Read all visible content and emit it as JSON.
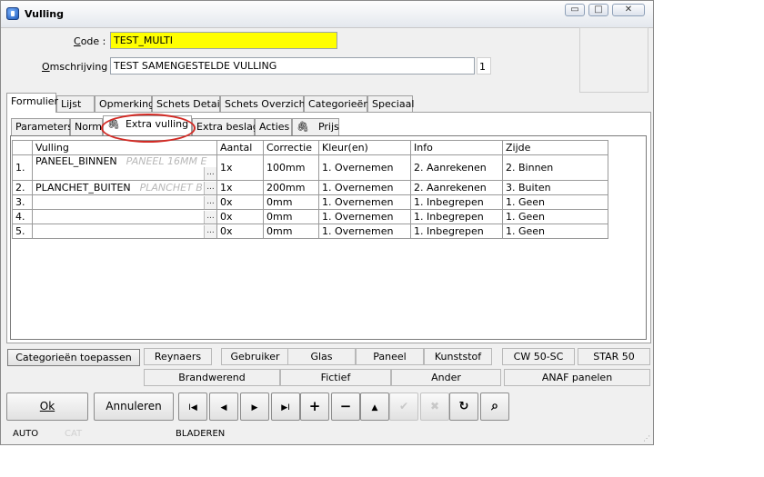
{
  "window": {
    "title": "Vulling",
    "caption_buttons": [
      "minimize",
      "maximize",
      "close"
    ]
  },
  "form": {
    "code_label": "Code :",
    "code_value": "TEST_MULTI",
    "omschrijving_label": "Omschrijving :",
    "omschrijving_value": "TEST SAMENGESTELDE VULLING",
    "omschrijving_count": "1",
    "code_bg": "#ffff00"
  },
  "main_tabs": [
    {
      "label": "Formulier",
      "active": true
    },
    {
      "label": "Lijst"
    },
    {
      "label": "Opmerking"
    },
    {
      "label": "Schets Detail"
    },
    {
      "label": "Schets Overzicht"
    },
    {
      "label": "Categorieën"
    },
    {
      "label": "Speciaal"
    }
  ],
  "sub_tabs": [
    {
      "label": "Parameters"
    },
    {
      "label": "Norm"
    },
    {
      "label": "Extra vulling",
      "active": true,
      "icon": "paperclip-icon"
    },
    {
      "label": "Extra beslag"
    },
    {
      "label": "Acties"
    },
    {
      "label": "Prijs",
      "icon": "paperclip-icon"
    }
  ],
  "grid": {
    "headers": [
      "",
      "Vulling",
      "Aantal",
      "Correctie",
      "Kleur(en)",
      "Info",
      "Zijde"
    ],
    "rows": [
      {
        "nr": "1.",
        "vulling": "PANEEL_BINNEN",
        "desc": "PANEEL 16MM E",
        "aantal": "1x",
        "correctie": "100mm",
        "kleur": "1. Overnemen",
        "info": "2. Aanrekenen",
        "zijde": "2. Binnen"
      },
      {
        "nr": "2.",
        "vulling": "PLANCHET_BUITEN",
        "desc": "PLANCHET B",
        "aantal": "1x",
        "correctie": "200mm",
        "kleur": "1. Overnemen",
        "info": "2. Aanrekenen",
        "zijde": "3. Buiten"
      },
      {
        "nr": "3.",
        "vulling": "",
        "desc": "",
        "aantal": "0x",
        "correctie": "0mm",
        "kleur": "1. Overnemen",
        "info": "1. Inbegrepen",
        "zijde": "1. Geen"
      },
      {
        "nr": "4.",
        "vulling": "",
        "desc": "",
        "aantal": "0x",
        "correctie": "0mm",
        "kleur": "1. Overnemen",
        "info": "1. Inbegrepen",
        "zijde": "1. Geen"
      },
      {
        "nr": "5.",
        "vulling": "",
        "desc": "",
        "aantal": "0x",
        "correctie": "0mm",
        "kleur": "1. Overnemen",
        "info": "1. Inbegrepen",
        "zijde": "1. Geen"
      }
    ],
    "dots_label": "..."
  },
  "categories": {
    "apply_button": "Categorieën toepassen",
    "row1": [
      "Reynaers",
      "Gebruiker",
      "Glas",
      "Paneel",
      "Kunststof",
      "CW 50-SC",
      "STAR 50"
    ],
    "row2": [
      "Brandwerend",
      "Fictief",
      "Ander",
      "ANAF panelen"
    ]
  },
  "buttons": {
    "ok": "Ok",
    "annuleren": "Annuleren",
    "nav": [
      {
        "icon": "first-record-icon",
        "glyph": "I◀",
        "disabled": false
      },
      {
        "icon": "previous-record-icon",
        "glyph": "◀",
        "disabled": false
      },
      {
        "icon": "next-record-icon",
        "glyph": "▶",
        "disabled": false
      },
      {
        "icon": "last-record-icon",
        "glyph": "▶I",
        "disabled": false
      },
      {
        "icon": "add-record-icon",
        "glyph": "+",
        "disabled": false
      },
      {
        "icon": "delete-record-icon",
        "glyph": "−",
        "disabled": false
      },
      {
        "icon": "edit-record-icon",
        "glyph": "▲",
        "disabled": false
      },
      {
        "icon": "confirm-icon",
        "glyph": "✔",
        "disabled": true
      },
      {
        "icon": "cancel-icon",
        "glyph": "✖",
        "disabled": true
      },
      {
        "icon": "refresh-icon",
        "glyph": "↻",
        "disabled": false
      },
      {
        "icon": "binoculars-icon",
        "glyph": "⌕",
        "disabled": false
      }
    ]
  },
  "status": {
    "mode": "AUTO",
    "cat": "CAT",
    "state": "BLADEREN"
  },
  "colors": {
    "highlight_ellipse": "#d22a24"
  }
}
